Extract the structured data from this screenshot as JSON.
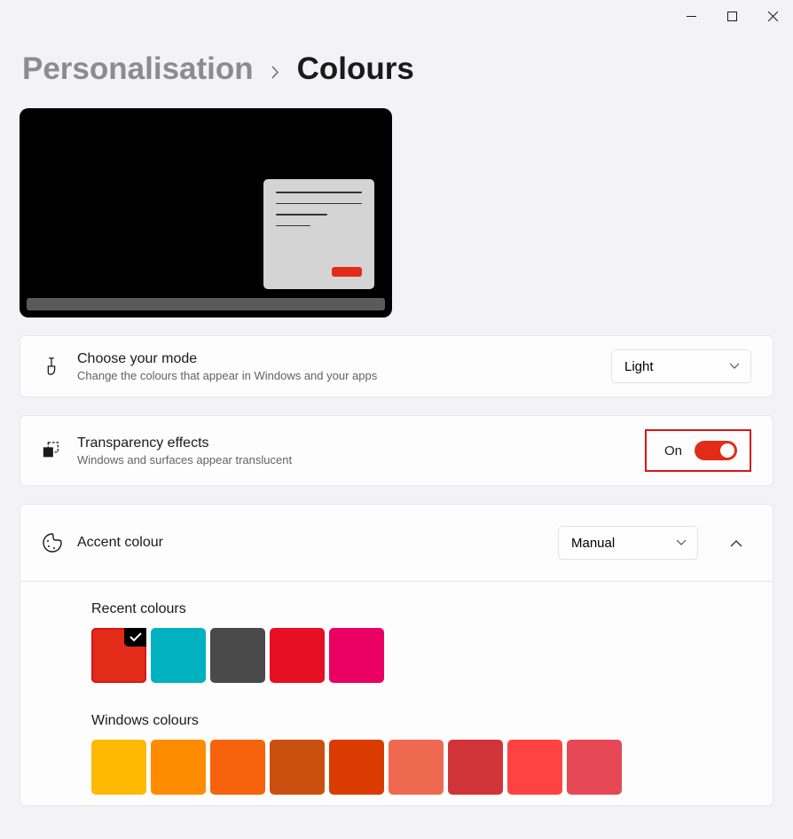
{
  "breadcrumb": {
    "parent": "Personalisation",
    "current": "Colours"
  },
  "mode": {
    "title": "Choose your mode",
    "sub": "Change the colours that appear in Windows and your apps",
    "selected": "Light"
  },
  "transparency": {
    "title": "Transparency effects",
    "sub": "Windows and surfaces appear translucent",
    "state": "On",
    "enabled": true
  },
  "accent": {
    "title": "Accent colour",
    "selected": "Manual",
    "expanded": true
  },
  "recent": {
    "title": "Recent colours",
    "items": [
      {
        "color": "#e32b19",
        "selected": true
      },
      {
        "color": "#00b2c0",
        "selected": false
      },
      {
        "color": "#4a4a4a",
        "selected": false
      },
      {
        "color": "#e60f24",
        "selected": false
      },
      {
        "color": "#ea0062",
        "selected": false
      }
    ]
  },
  "windows": {
    "title": "Windows colours",
    "items": [
      {
        "color": "#ffb900"
      },
      {
        "color": "#ff8c00"
      },
      {
        "color": "#f7630c"
      },
      {
        "color": "#ca5010"
      },
      {
        "color": "#da3b01"
      },
      {
        "color": "#ef6950"
      },
      {
        "color": "#d13438"
      },
      {
        "color": "#ff4343"
      },
      {
        "color": "#e74856"
      }
    ]
  }
}
